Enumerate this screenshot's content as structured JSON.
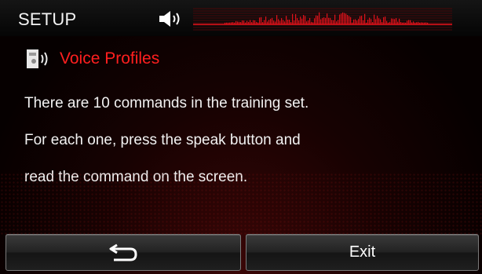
{
  "header": {
    "title": "SETUP",
    "volume_icon": "speaker-icon",
    "waveform_icon": "audio-waveform-icon",
    "accent_color": "#e0121b"
  },
  "section": {
    "icon": "voice-profile-icon",
    "title": "Voice Profiles",
    "title_color": "#ff1f1f"
  },
  "message": {
    "lines": [
      "There are 10 commands in the training set.",
      "For each one, press the speak button and",
      "read the command on the screen."
    ]
  },
  "buttons": {
    "back_icon": "return-arrow-icon",
    "exit_label": "Exit"
  }
}
